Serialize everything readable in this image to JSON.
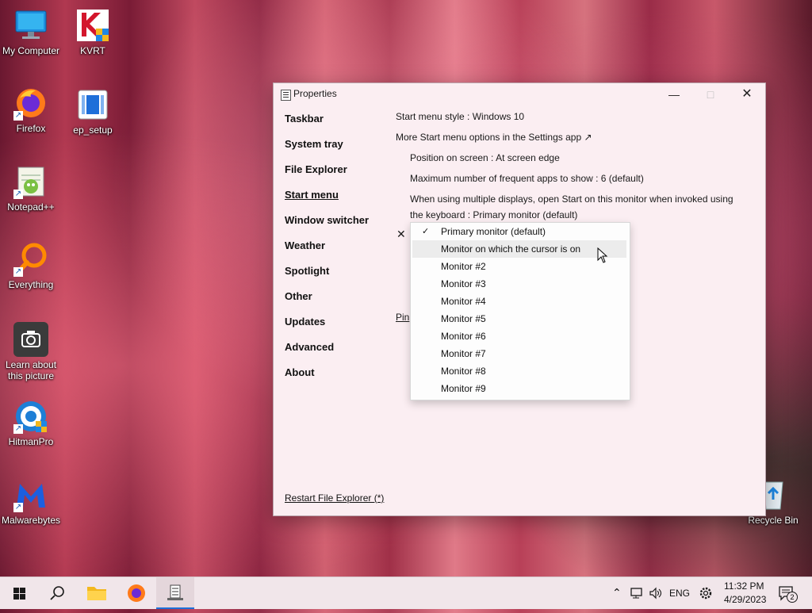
{
  "desktop": {
    "icons": [
      {
        "label": "My Computer"
      },
      {
        "label": "KVRT"
      },
      {
        "label": "Firefox"
      },
      {
        "label": "ep_setup"
      },
      {
        "label": "Notepad++"
      },
      {
        "label": "Everything"
      },
      {
        "label": "Learn about this picture"
      },
      {
        "label": "HitmanPro"
      },
      {
        "label": "Malwarebytes"
      },
      {
        "label": "Recycle Bin"
      }
    ]
  },
  "window": {
    "title": "Properties",
    "sidebar": [
      {
        "label": "Taskbar"
      },
      {
        "label": "System tray"
      },
      {
        "label": "File Explorer"
      },
      {
        "label": "Start menu"
      },
      {
        "label": "Window switcher"
      },
      {
        "label": "Weather"
      },
      {
        "label": "Spotlight"
      },
      {
        "label": "Other"
      },
      {
        "label": "Updates"
      },
      {
        "label": "Advanced"
      },
      {
        "label": "About"
      }
    ],
    "restart_link": "Restart File Explorer (*)",
    "content": {
      "start_menu_style": "Start menu style : Windows 10",
      "more_options": "More Start menu options in the Settings app ↗",
      "position": "Position on screen : At screen edge",
      "max_frequent": "Maximum number of frequent apps to show : 6 (default)",
      "multi_display_1": "When using multiple displays, open Start on this monitor when invoked using",
      "multi_display_2": "the keyboard : Primary monitor (default)",
      "x_mark": "✕",
      "pin_partial": "Pin"
    },
    "dropdown": {
      "items": [
        {
          "label": "Primary monitor (default)",
          "checked": true
        },
        {
          "label": "Monitor on which the cursor is on",
          "hovered": true
        },
        {
          "label": "Monitor #2"
        },
        {
          "label": "Monitor #3"
        },
        {
          "label": "Monitor #4"
        },
        {
          "label": "Monitor #5"
        },
        {
          "label": "Monitor #6"
        },
        {
          "label": "Monitor #7"
        },
        {
          "label": "Monitor #8"
        },
        {
          "label": "Monitor #9"
        }
      ]
    }
  },
  "taskbar": {
    "pinned": [
      "start-icon",
      "search-icon",
      "file-explorer-icon",
      "firefox-icon",
      "properties-app-icon"
    ],
    "tray": {
      "language": "ENG",
      "time": "11:32 PM",
      "date": "4/29/2023",
      "notification_count": "2"
    }
  }
}
